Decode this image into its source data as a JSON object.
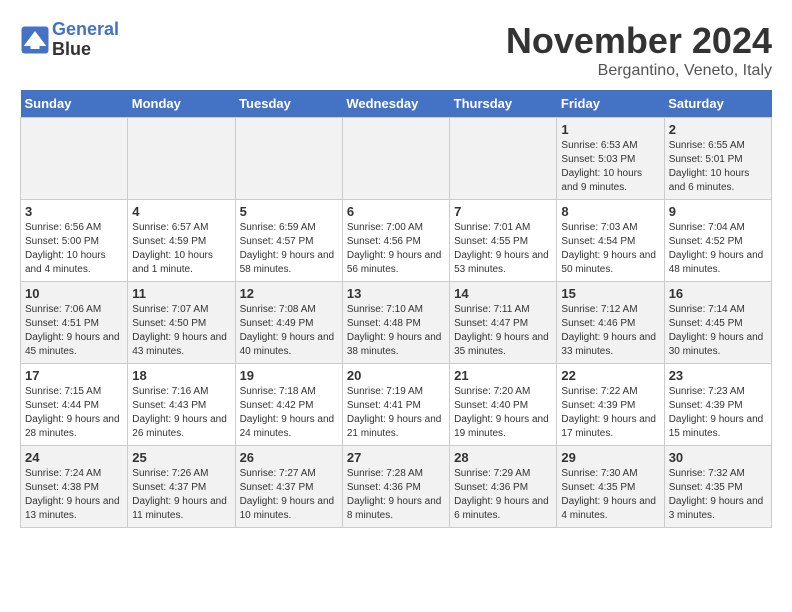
{
  "header": {
    "logo_line1": "General",
    "logo_line2": "Blue",
    "month": "November 2024",
    "location": "Bergantino, Veneto, Italy"
  },
  "weekdays": [
    "Sunday",
    "Monday",
    "Tuesday",
    "Wednesday",
    "Thursday",
    "Friday",
    "Saturday"
  ],
  "weeks": [
    [
      {
        "day": "",
        "info": ""
      },
      {
        "day": "",
        "info": ""
      },
      {
        "day": "",
        "info": ""
      },
      {
        "day": "",
        "info": ""
      },
      {
        "day": "",
        "info": ""
      },
      {
        "day": "1",
        "info": "Sunrise: 6:53 AM\nSunset: 5:03 PM\nDaylight: 10 hours and 9 minutes."
      },
      {
        "day": "2",
        "info": "Sunrise: 6:55 AM\nSunset: 5:01 PM\nDaylight: 10 hours and 6 minutes."
      }
    ],
    [
      {
        "day": "3",
        "info": "Sunrise: 6:56 AM\nSunset: 5:00 PM\nDaylight: 10 hours and 4 minutes."
      },
      {
        "day": "4",
        "info": "Sunrise: 6:57 AM\nSunset: 4:59 PM\nDaylight: 10 hours and 1 minute."
      },
      {
        "day": "5",
        "info": "Sunrise: 6:59 AM\nSunset: 4:57 PM\nDaylight: 9 hours and 58 minutes."
      },
      {
        "day": "6",
        "info": "Sunrise: 7:00 AM\nSunset: 4:56 PM\nDaylight: 9 hours and 56 minutes."
      },
      {
        "day": "7",
        "info": "Sunrise: 7:01 AM\nSunset: 4:55 PM\nDaylight: 9 hours and 53 minutes."
      },
      {
        "day": "8",
        "info": "Sunrise: 7:03 AM\nSunset: 4:54 PM\nDaylight: 9 hours and 50 minutes."
      },
      {
        "day": "9",
        "info": "Sunrise: 7:04 AM\nSunset: 4:52 PM\nDaylight: 9 hours and 48 minutes."
      }
    ],
    [
      {
        "day": "10",
        "info": "Sunrise: 7:06 AM\nSunset: 4:51 PM\nDaylight: 9 hours and 45 minutes."
      },
      {
        "day": "11",
        "info": "Sunrise: 7:07 AM\nSunset: 4:50 PM\nDaylight: 9 hours and 43 minutes."
      },
      {
        "day": "12",
        "info": "Sunrise: 7:08 AM\nSunset: 4:49 PM\nDaylight: 9 hours and 40 minutes."
      },
      {
        "day": "13",
        "info": "Sunrise: 7:10 AM\nSunset: 4:48 PM\nDaylight: 9 hours and 38 minutes."
      },
      {
        "day": "14",
        "info": "Sunrise: 7:11 AM\nSunset: 4:47 PM\nDaylight: 9 hours and 35 minutes."
      },
      {
        "day": "15",
        "info": "Sunrise: 7:12 AM\nSunset: 4:46 PM\nDaylight: 9 hours and 33 minutes."
      },
      {
        "day": "16",
        "info": "Sunrise: 7:14 AM\nSunset: 4:45 PM\nDaylight: 9 hours and 30 minutes."
      }
    ],
    [
      {
        "day": "17",
        "info": "Sunrise: 7:15 AM\nSunset: 4:44 PM\nDaylight: 9 hours and 28 minutes."
      },
      {
        "day": "18",
        "info": "Sunrise: 7:16 AM\nSunset: 4:43 PM\nDaylight: 9 hours and 26 minutes."
      },
      {
        "day": "19",
        "info": "Sunrise: 7:18 AM\nSunset: 4:42 PM\nDaylight: 9 hours and 24 minutes."
      },
      {
        "day": "20",
        "info": "Sunrise: 7:19 AM\nSunset: 4:41 PM\nDaylight: 9 hours and 21 minutes."
      },
      {
        "day": "21",
        "info": "Sunrise: 7:20 AM\nSunset: 4:40 PM\nDaylight: 9 hours and 19 minutes."
      },
      {
        "day": "22",
        "info": "Sunrise: 7:22 AM\nSunset: 4:39 PM\nDaylight: 9 hours and 17 minutes."
      },
      {
        "day": "23",
        "info": "Sunrise: 7:23 AM\nSunset: 4:39 PM\nDaylight: 9 hours and 15 minutes."
      }
    ],
    [
      {
        "day": "24",
        "info": "Sunrise: 7:24 AM\nSunset: 4:38 PM\nDaylight: 9 hours and 13 minutes."
      },
      {
        "day": "25",
        "info": "Sunrise: 7:26 AM\nSunset: 4:37 PM\nDaylight: 9 hours and 11 minutes."
      },
      {
        "day": "26",
        "info": "Sunrise: 7:27 AM\nSunset: 4:37 PM\nDaylight: 9 hours and 10 minutes."
      },
      {
        "day": "27",
        "info": "Sunrise: 7:28 AM\nSunset: 4:36 PM\nDaylight: 9 hours and 8 minutes."
      },
      {
        "day": "28",
        "info": "Sunrise: 7:29 AM\nSunset: 4:36 PM\nDaylight: 9 hours and 6 minutes."
      },
      {
        "day": "29",
        "info": "Sunrise: 7:30 AM\nSunset: 4:35 PM\nDaylight: 9 hours and 4 minutes."
      },
      {
        "day": "30",
        "info": "Sunrise: 7:32 AM\nSunset: 4:35 PM\nDaylight: 9 hours and 3 minutes."
      }
    ]
  ]
}
